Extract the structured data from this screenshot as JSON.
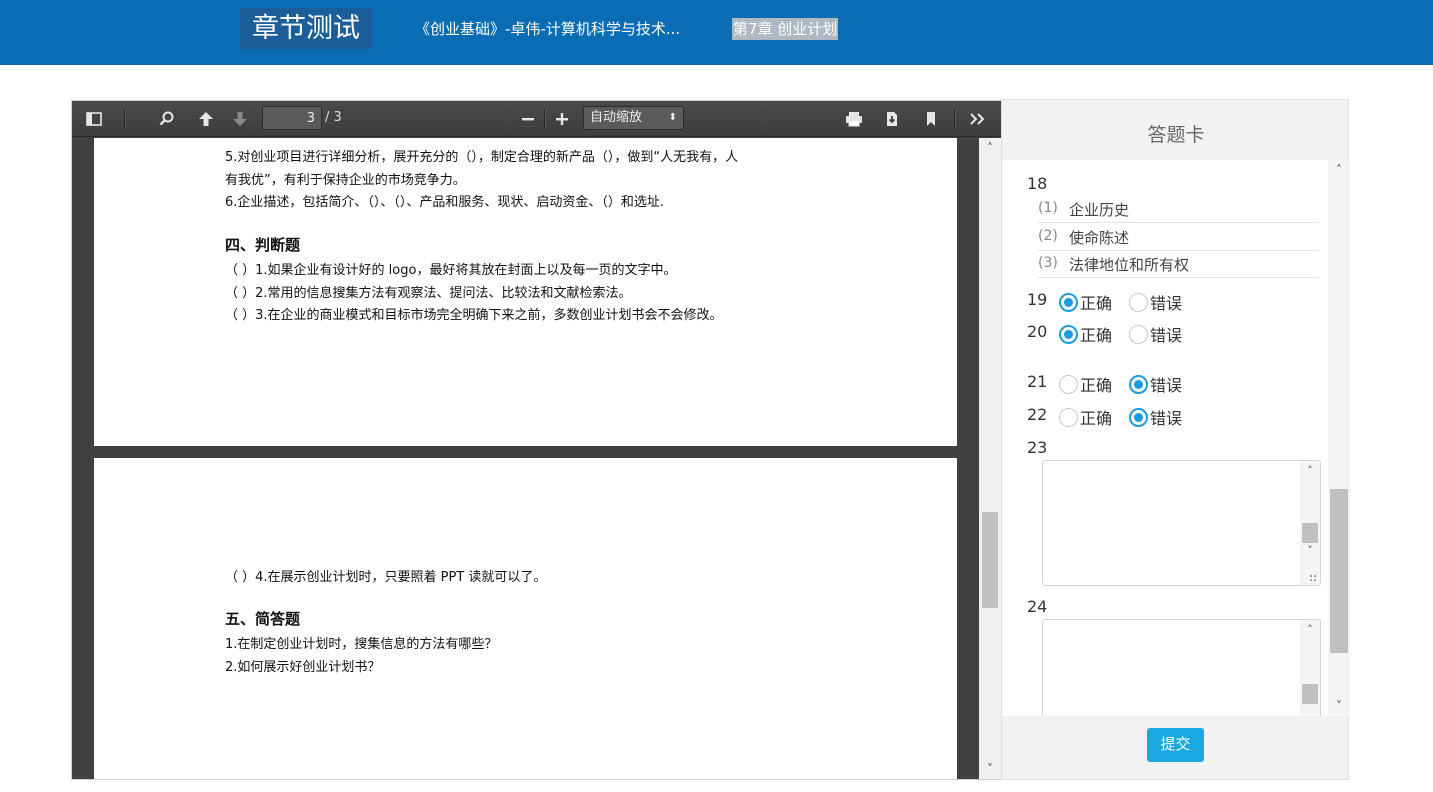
{
  "header": {
    "app_title": "章节测试",
    "course_title": "《创业基础》-卓伟-计算机科学与技术...",
    "chapter_title": "第7章 创业计划"
  },
  "pdf": {
    "current_page": "3",
    "page_count": "/ 3",
    "zoom_label": "自动缩放",
    "page_a_lines": [
      "5.对创业项目进行详细分析，展开充分的（），制定合理的新产品（），做到“人无我有，人",
      "有我优”，有利于保持企业的市场竞争力。",
      "6.企业描述，包括简介、（）、（）、产品和服务、现状、启动资金、（）和选址."
    ],
    "section4_heading": "四、判断题",
    "judge_items": [
      "（    ）1.如果企业有设计好的 logo，最好将其放在封面上以及每一页的文字中。",
      "（    ）2.常用的信息搜集方法有观察法、提问法、比较法和文献检索法。",
      "（    ）3.在企业的商业模式和目标市场完全明确下来之前，多数创业计划书会不会修改。"
    ],
    "judge_item4": "（    ）4.在展示创业计划时，只要照着 PPT 读就可以了。",
    "section5_heading": "五、简答题",
    "short_answers": [
      "1.在制定创业计划时，搜集信息的方法有哪些？",
      "2.如何展示好创业计划书？"
    ]
  },
  "card": {
    "title": "答题卡",
    "q18": {
      "num": "18",
      "subs": [
        {
          "idx": "(1)",
          "value": "企业历史"
        },
        {
          "idx": "(2)",
          "value": "使命陈述"
        },
        {
          "idx": "(3)",
          "value": "法律地位和所有权"
        }
      ]
    },
    "judge": [
      {
        "num": "19",
        "true_label": "正确",
        "false_label": "错误",
        "selected": "true"
      },
      {
        "num": "20",
        "true_label": "正确",
        "false_label": "错误",
        "selected": "true"
      },
      {
        "num": "21",
        "true_label": "正确",
        "false_label": "错误",
        "selected": "false"
      },
      {
        "num": "22",
        "true_label": "正确",
        "false_label": "错误",
        "selected": "false"
      }
    ],
    "q23": {
      "num": "23"
    },
    "q24": {
      "num": "24"
    },
    "submit_label": "提交"
  },
  "colors": {
    "header_bg": "#0a6cb3",
    "accent": "#1aa8e0",
    "radio_selected": "#1a9be0"
  }
}
